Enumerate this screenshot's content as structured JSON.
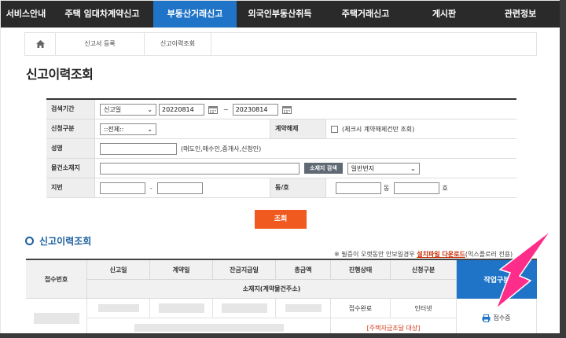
{
  "nav": {
    "items": [
      "서비스안내",
      "주택 임대차계약신고",
      "부동산거래신고",
      "외국인부동산취득",
      "주택거래신고",
      "게시판",
      "관련정보"
    ],
    "active_index": 2
  },
  "breadcrumb": {
    "level1": "신고서 등록",
    "level2": "신고이력조회"
  },
  "page_title": "신고이력조회",
  "form": {
    "period_label": "검색기간",
    "period_type": "신고일",
    "date_from": "20220814",
    "date_sep": "~",
    "date_to": "20230814",
    "apply_type_label": "신청구분",
    "apply_type_value": "::전체::",
    "cancel_label": "계약해제",
    "cancel_hint": "(체크시 계약해제건만 조회)",
    "name_label": "성명",
    "name_hint": "(매도인,매수인,중개사,신청인)",
    "address_label": "물건소재지",
    "address_search_button": "소재지 검색",
    "address_type": "일반번지",
    "lot_label": "지번",
    "lot_sep": "-",
    "dong_label": "동/호",
    "dong_unit": "동",
    "ho_unit": "호",
    "search_button": "조회"
  },
  "results": {
    "section_title": "신고이력조회",
    "note_prefix": "※ 필증이 오랫동안 안보일경우 ",
    "note_link": "설치파일 다운로드",
    "note_suffix": "(익스플로러 전용)",
    "headers": {
      "receipt_no": "접수번호",
      "report_date": "신고일",
      "contract_date": "계약일",
      "balance_date": "잔금지급일",
      "total_amount": "총금액",
      "progress": "진행상태",
      "apply_type": "신청구분",
      "work_type": "작업구분",
      "address": "소재지(계약물건주소)"
    },
    "row": {
      "progress": "접수완료",
      "apply_type": "인터넷",
      "balance_note": "[주택자금조달 대상]",
      "receipt_button": "접수증"
    }
  },
  "colors": {
    "nav_bg": "#2a2a2a",
    "nav_active": "#1f74c8",
    "search_button": "#f05a1e",
    "annotation_arrow": "#ff2d8a"
  }
}
